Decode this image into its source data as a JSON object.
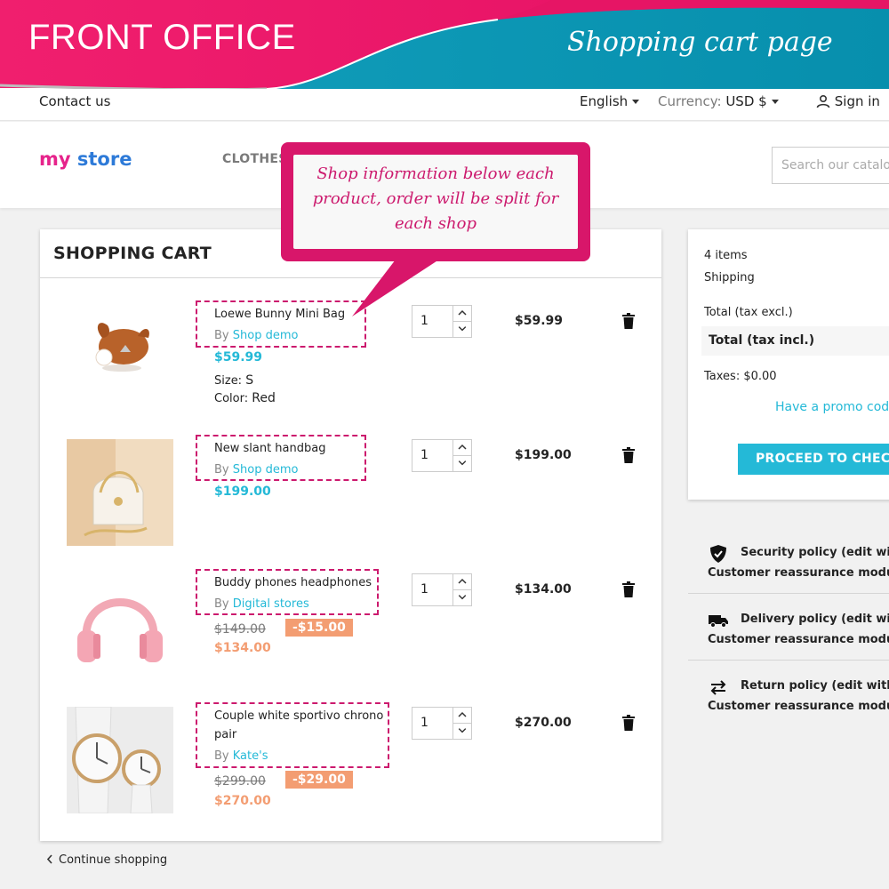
{
  "banner": {
    "left_label": "FRONT OFFICE",
    "right_label": "Shopping cart page"
  },
  "topnav": {
    "contact": "Contact us",
    "language": "English",
    "currency_label": "Currency:",
    "currency_value": "USD $",
    "signin": "Sign in"
  },
  "header": {
    "logo_my": "my",
    "logo_store": "store",
    "menu_clothes": "CLOTHES",
    "search_placeholder": "Search our catalog"
  },
  "callout": {
    "line1": "Shop information below each",
    "line2": "product, order will be split for",
    "line3": "each shop"
  },
  "cart": {
    "title": "SHOPPING CART",
    "items": [
      {
        "name": "Loewe Bunny Mini Bag",
        "by": "By",
        "shop": "Shop demo",
        "price": "$59.99",
        "size_label": "Size:",
        "size_value": "S",
        "color_label": "Color:",
        "color_value": "Red",
        "qty": "1",
        "total": "$59.99"
      },
      {
        "name": "New slant handbag",
        "by": "By",
        "shop": "Shop demo",
        "price": "$199.00",
        "qty": "1",
        "total": "$199.00"
      },
      {
        "name": "Buddy phones headphones",
        "by": "By",
        "shop": "Digital stores",
        "old_price": "$149.00",
        "discount": "-$15.00",
        "price": "$134.00",
        "qty": "1",
        "total": "$134.00"
      },
      {
        "name_line1": "Couple white sportivo chrono",
        "name_line2": "pair",
        "by": "By",
        "shop": "Kate's",
        "old_price": "$299.00",
        "discount": "-$29.00",
        "price": "$270.00",
        "qty": "1",
        "total": "$270.00"
      }
    ],
    "continue": "Continue shopping"
  },
  "summary": {
    "items_count": "4 items",
    "shipping": "Shipping",
    "total_excl": "Total (tax excl.)",
    "total_incl": "Total (tax incl.)",
    "taxes": "Taxes: $0.00",
    "promo": "Have a promo code?",
    "checkout": "PROCEED TO CHECKOUT"
  },
  "reassurance": [
    {
      "icon": "shield-check-icon",
      "text": "Security policy (edit with Customer reassurance module)"
    },
    {
      "icon": "truck-icon",
      "text": "Delivery policy (edit with Customer reassurance module)"
    },
    {
      "icon": "swap-arrows-icon",
      "text": "Return policy (edit with Customer reassurance module)"
    }
  ],
  "colors": {
    "accent": "#24b9d7",
    "banner_pink": "#ec1267",
    "banner_teal": "#0a9ab8",
    "discount": "#f39d72",
    "callout": "#d8166a"
  }
}
